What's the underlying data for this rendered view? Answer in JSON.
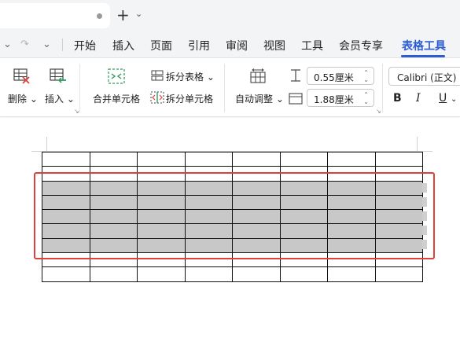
{
  "menubar": {
    "items": [
      "开始",
      "插入",
      "页面",
      "引用",
      "审阅",
      "视图",
      "工具",
      "会员专享",
      "表格工具"
    ],
    "active_index": 8
  },
  "ribbon": {
    "delete_label": "删除",
    "insert_label": "插入",
    "merge_cells_label": "合并单元格",
    "split_table_label": "拆分表格",
    "split_cells_label": "拆分单元格",
    "auto_fit_label": "自动调整",
    "row_height_value": "0.55厘米",
    "column_width_value": "1.88厘米",
    "font_name": "Calibri (正文)",
    "bold": "B",
    "italic": "I",
    "underline": "U"
  },
  "table": {
    "columns": 8,
    "rows": 9,
    "selected_rows": [
      2,
      3,
      4,
      5,
      6
    ]
  },
  "colors": {
    "accent": "#2a5cd4",
    "selection_box": "#e0403a",
    "selected_cell": "#c8c8c8"
  }
}
